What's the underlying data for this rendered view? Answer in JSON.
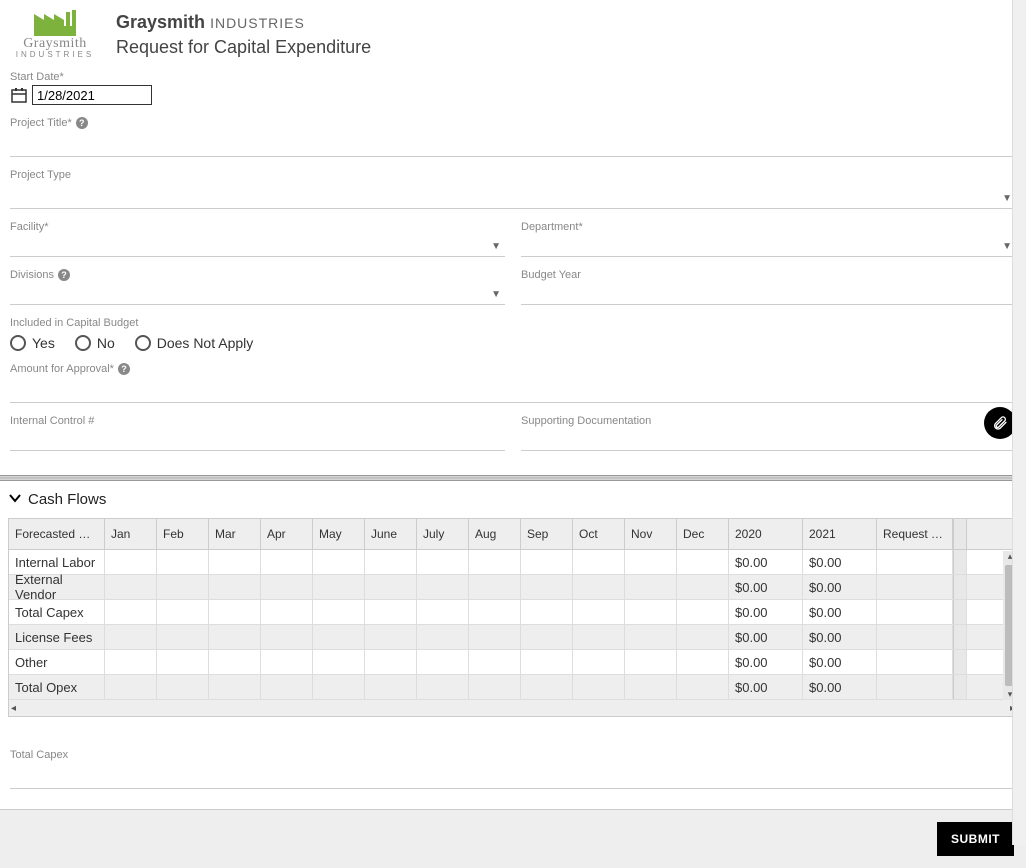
{
  "header": {
    "company_bold": "Graysmith",
    "company_light": "INDUSTRIES",
    "subtitle": "Request for Capital Expenditure",
    "logo_text": "Graysmith",
    "logo_sub": "INDUSTRIES"
  },
  "fields": {
    "start_date_label": "Start Date*",
    "start_date_value": "1/28/2021",
    "project_title_label": "Project Title*",
    "project_type_label": "Project Type",
    "facility_label": "Facility*",
    "department_label": "Department*",
    "divisions_label": "Divisions",
    "budget_year_label": "Budget Year",
    "included_label": "Included in Capital Budget",
    "radio_yes": "Yes",
    "radio_no": "No",
    "radio_na": "Does Not Apply",
    "amount_label": "Amount for Approval*",
    "internal_control_label": "Internal Control #",
    "supporting_label": "Supporting Documentation",
    "total_capex_label": "Total Capex"
  },
  "section": {
    "cash_flows": "Cash Flows"
  },
  "table": {
    "columns": {
      "spend": "Forecasted Spe…",
      "jan": "Jan",
      "feb": "Feb",
      "mar": "Mar",
      "apr": "Apr",
      "may": "May",
      "jun": "June",
      "jul": "July",
      "aug": "Aug",
      "sep": "Sep",
      "oct": "Oct",
      "nov": "Nov",
      "dec": "Dec",
      "y2020": "2020",
      "y2021": "2021",
      "total": "Request To…"
    },
    "rows": [
      {
        "label": "Internal Labor",
        "y2020": "$0.00",
        "y2021": "$0.00"
      },
      {
        "label": "External Vendor",
        "y2020": "$0.00",
        "y2021": "$0.00"
      },
      {
        "label": "Total Capex",
        "y2020": "$0.00",
        "y2021": "$0.00"
      },
      {
        "label": "License Fees",
        "y2020": "$0.00",
        "y2021": "$0.00"
      },
      {
        "label": "Other",
        "y2020": "$0.00",
        "y2021": "$0.00"
      },
      {
        "label": "Total Opex",
        "y2020": "$0.00",
        "y2021": "$0.00"
      }
    ]
  },
  "footer": {
    "submit": "SUBMIT"
  }
}
